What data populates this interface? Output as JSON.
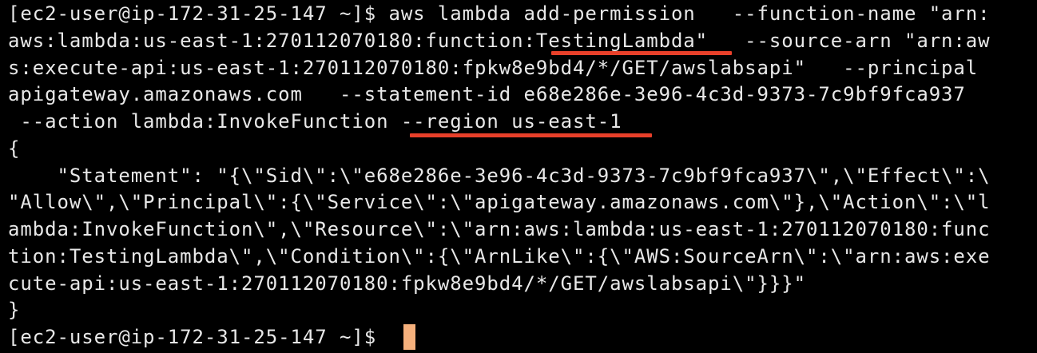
{
  "terminal": {
    "lines": [
      "[ec2-user@ip-172-31-25-147 ~]$ aws lambda add-permission   --function-name \"arn:",
      "aws:lambda:us-east-1:270112070180:function:TestingLambda\"   --source-arn \"arn:aw",
      "s:execute-api:us-east-1:270112070180:fpkw8e9bd4/*/GET/awslabsapi\"   --principal",
      "apigateway.amazonaws.com   --statement-id e68e286e-3e96-4c3d-9373-7c9bf9fca937",
      " --action lambda:InvokeFunction --region us-east-1",
      "{",
      "    \"Statement\": \"{\\\"Sid\\\":\\\"e68e286e-3e96-4c3d-9373-7c9bf9fca937\\\",\\\"Effect\\\":\\",
      "\"Allow\\\",\\\"Principal\\\":{\\\"Service\\\":\\\"apigateway.amazonaws.com\\\"},\\\"Action\\\":\\\"l",
      "ambda:InvokeFunction\\\",\\\"Resource\\\":\\\"arn:aws:lambda:us-east-1:270112070180:func",
      "tion:TestingLambda\\\",\\\"Condition\\\":{\\\"ArnLike\\\":{\\\"AWS:SourceArn\\\":\\\"arn:aws:exe",
      "cute-api:us-east-1:270112070180:fpkw8e9bd4/*/GET/awslabsapi\\\"}}}\"",
      "}",
      "[ec2-user@ip-172-31-25-147 ~]$ "
    ]
  },
  "colors": {
    "background": "#000000",
    "text": "#e8e8e8",
    "highlight_underline": "#e8402a",
    "cursor": "#f5b07c"
  }
}
